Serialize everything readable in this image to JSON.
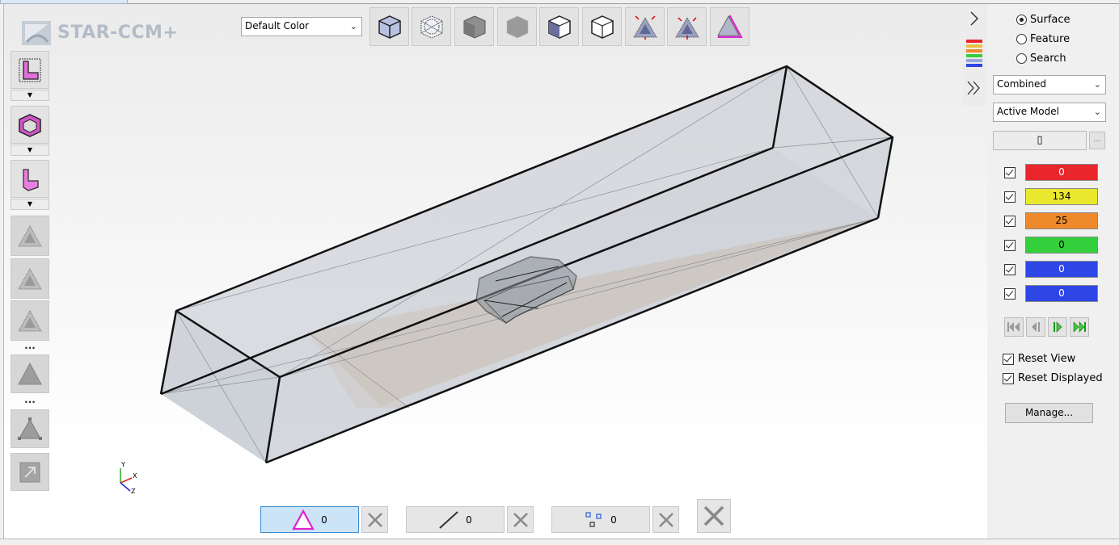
{
  "app": {
    "logo_text": "STAR-CCM+"
  },
  "toolbar": {
    "color_mode": {
      "selected": "Default Color"
    },
    "buttons": [
      {
        "name": "solid-cube-view-icon"
      },
      {
        "name": "wireframe-sphere-view-icon"
      },
      {
        "name": "gray-solid-cube-icon"
      },
      {
        "name": "gray-mesh-cube-icon"
      },
      {
        "name": "shaded-faces-cube-icon"
      },
      {
        "name": "outline-cube-icon"
      },
      {
        "name": "expand-triangle-icon"
      },
      {
        "name": "contract-triangle-icon"
      },
      {
        "name": "pink-triangle-icon"
      }
    ]
  },
  "left_toolbar": {
    "dots_1": "...",
    "dots_2": "..."
  },
  "bottom_bar": {
    "faces_count": "0",
    "edges_count": "0",
    "vertices_count": "0"
  },
  "right_panel": {
    "selection_modes": [
      {
        "label": "Surface",
        "selected": true
      },
      {
        "label": "Feature",
        "selected": false
      },
      {
        "label": "Search",
        "selected": false
      }
    ],
    "combined_select": "Combined",
    "model_select": "Active Model",
    "filter_value": "▯",
    "filter_more": "...",
    "legend": [
      {
        "value": "0",
        "color": "#e8262b",
        "text_color": "#ffffff"
      },
      {
        "value": "134",
        "color": "#e9e82e",
        "text_color": "#000000"
      },
      {
        "value": "25",
        "color": "#ee8a2c",
        "text_color": "#000000"
      },
      {
        "value": "0",
        "color": "#34d03c",
        "text_color": "#000000"
      },
      {
        "value": "0",
        "color": "#2e46e6",
        "text_color": "#ffffff"
      },
      {
        "value": "0",
        "color": "#2e46e6",
        "text_color": "#ffffff"
      }
    ],
    "reset_view_label": "Reset View",
    "reset_displayed_label": "Reset Displayed",
    "manage_label": "Manage..."
  }
}
